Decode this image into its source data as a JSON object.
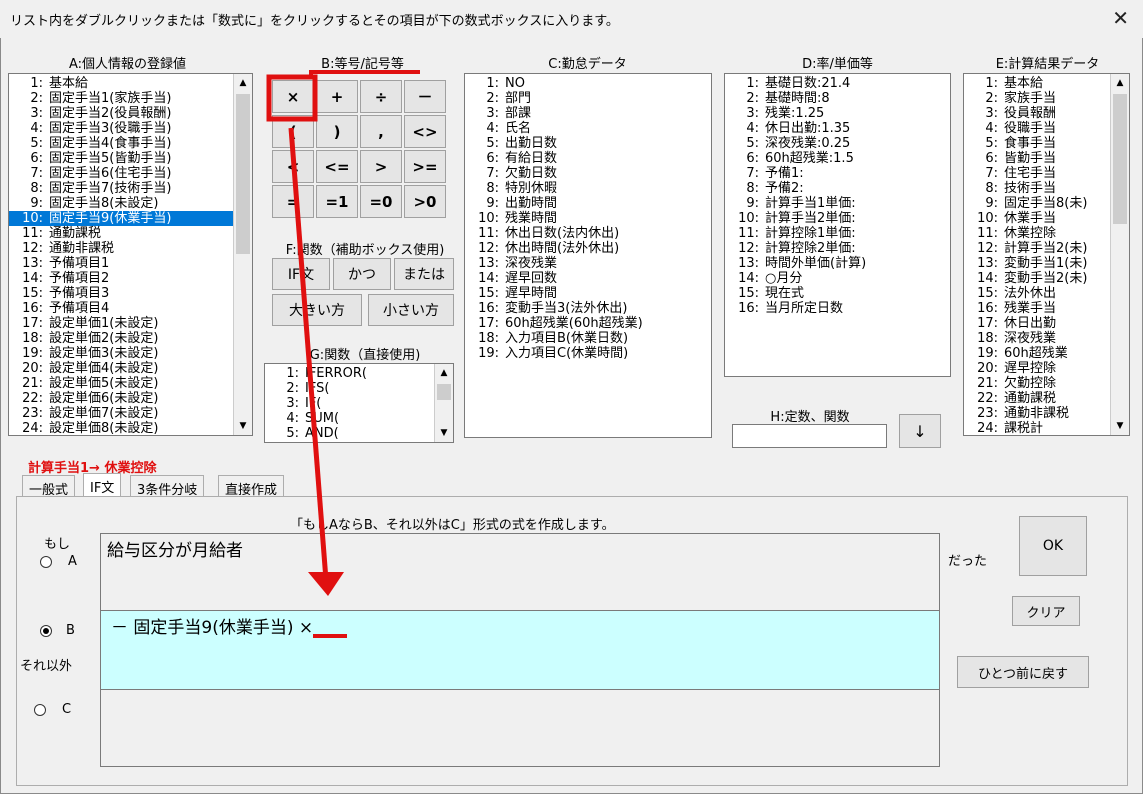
{
  "window": {
    "title": "リスト内をダブルクリックまたは「数式に」をクリックするとその項目が下の数式ボックスに入ります。",
    "close": "✕"
  },
  "panelA": {
    "header": "A:個人情報の登録値",
    "items": [
      {
        "n": "1:",
        "t": "基本給"
      },
      {
        "n": "2:",
        "t": "固定手当1(家族手当)"
      },
      {
        "n": "3:",
        "t": "固定手当2(役員報酬)"
      },
      {
        "n": "4:",
        "t": "固定手当3(役職手当)"
      },
      {
        "n": "5:",
        "t": "固定手当4(食事手当)"
      },
      {
        "n": "6:",
        "t": "固定手当5(皆勤手当)"
      },
      {
        "n": "7:",
        "t": "固定手当6(住宅手当)"
      },
      {
        "n": "8:",
        "t": "固定手当7(技術手当)"
      },
      {
        "n": "9:",
        "t": "固定手当8(未設定)"
      },
      {
        "n": "10:",
        "t": "固定手当9(休業手当)"
      },
      {
        "n": "11:",
        "t": "通勤課税"
      },
      {
        "n": "12:",
        "t": "通勤非課税"
      },
      {
        "n": "13:",
        "t": "予備項目1"
      },
      {
        "n": "14:",
        "t": "予備項目2"
      },
      {
        "n": "15:",
        "t": "予備項目3"
      },
      {
        "n": "16:",
        "t": "予備項目4"
      },
      {
        "n": "17:",
        "t": "設定単価1(未設定)"
      },
      {
        "n": "18:",
        "t": "設定単価2(未設定)"
      },
      {
        "n": "19:",
        "t": "設定単価3(未設定)"
      },
      {
        "n": "20:",
        "t": "設定単価4(未設定)"
      },
      {
        "n": "21:",
        "t": "設定単価5(未設定)"
      },
      {
        "n": "22:",
        "t": "設定単価6(未設定)"
      },
      {
        "n": "23:",
        "t": "設定単価7(未設定)"
      },
      {
        "n": "24:",
        "t": "設定単価8(未設定)"
      }
    ],
    "selected_index": 9
  },
  "panelB": {
    "header": "B:等号/記号等",
    "buttons": [
      [
        "×",
        "+",
        "÷",
        "－"
      ],
      [
        "(",
        ")",
        ",",
        "<>"
      ],
      [
        "<",
        "<=",
        ">",
        ">="
      ],
      [
        "=",
        "=1",
        "=0",
        ">0"
      ]
    ]
  },
  "panelF": {
    "header": "F:関数（補助ボックス使用)",
    "buttons": [
      "IF文",
      "かつ",
      "または",
      "大きい方",
      "小さい方"
    ]
  },
  "panelG": {
    "header": "G:関数（直接使用)",
    "items": [
      {
        "n": "1:",
        "t": "IFERROR("
      },
      {
        "n": "2:",
        "t": "IFS("
      },
      {
        "n": "3:",
        "t": "IF("
      },
      {
        "n": "4:",
        "t": "SUM("
      },
      {
        "n": "5:",
        "t": "AND("
      }
    ]
  },
  "panelC": {
    "header": "C:勤怠データ",
    "items": [
      {
        "n": "1:",
        "t": "NO"
      },
      {
        "n": "2:",
        "t": "部門"
      },
      {
        "n": "3:",
        "t": "部課"
      },
      {
        "n": "4:",
        "t": "氏名"
      },
      {
        "n": "5:",
        "t": "出勤日数"
      },
      {
        "n": "6:",
        "t": "有給日数"
      },
      {
        "n": "7:",
        "t": "欠勤日数"
      },
      {
        "n": "8:",
        "t": "特別休暇"
      },
      {
        "n": "9:",
        "t": "出勤時間"
      },
      {
        "n": "10:",
        "t": "残業時間"
      },
      {
        "n": "11:",
        "t": "休出日数(法内休出)"
      },
      {
        "n": "12:",
        "t": "休出時間(法外休出)"
      },
      {
        "n": "13:",
        "t": "深夜残業"
      },
      {
        "n": "14:",
        "t": "遅早回数"
      },
      {
        "n": "15:",
        "t": "遅早時間"
      },
      {
        "n": "16:",
        "t": "変動手当3(法外休出)"
      },
      {
        "n": "17:",
        "t": "60h超残業(60h超残業)"
      },
      {
        "n": "18:",
        "t": "入力項目B(休業日数)"
      },
      {
        "n": "19:",
        "t": "入力項目C(休業時間)"
      }
    ]
  },
  "panelD": {
    "header": "D:率/単価等",
    "items": [
      {
        "n": "1:",
        "t": "基礎日数:21.4"
      },
      {
        "n": "2:",
        "t": "基礎時間:8"
      },
      {
        "n": "3:",
        "t": "残業:1.25"
      },
      {
        "n": "4:",
        "t": "休日出勤:1.35"
      },
      {
        "n": "5:",
        "t": "深夜残業:0.25"
      },
      {
        "n": "6:",
        "t": "60h超残業:1.5"
      },
      {
        "n": "7:",
        "t": "予備1:"
      },
      {
        "n": "8:",
        "t": "予備2:"
      },
      {
        "n": "9:",
        "t": "計算手当1単価:"
      },
      {
        "n": "10:",
        "t": "計算手当2単価:"
      },
      {
        "n": "11:",
        "t": "計算控除1単価:"
      },
      {
        "n": "12:",
        "t": "計算控除2単価:"
      },
      {
        "n": "13:",
        "t": "時間外単価(計算)"
      },
      {
        "n": "14:",
        "t": "○月分"
      },
      {
        "n": "15:",
        "t": "現在式"
      },
      {
        "n": "16:",
        "t": "当月所定日数"
      }
    ]
  },
  "panelH": {
    "header": "H:定数、関数",
    "value": "",
    "arrow": "↓"
  },
  "panelE": {
    "header": "E:計算結果データ",
    "items": [
      {
        "n": "1:",
        "t": "基本給"
      },
      {
        "n": "2:",
        "t": "家族手当"
      },
      {
        "n": "3:",
        "t": "役員報酬"
      },
      {
        "n": "4:",
        "t": "役職手当"
      },
      {
        "n": "5:",
        "t": "食事手当"
      },
      {
        "n": "6:",
        "t": "皆勤手当"
      },
      {
        "n": "7:",
        "t": "住宅手当"
      },
      {
        "n": "8:",
        "t": "技術手当"
      },
      {
        "n": "9:",
        "t": "固定手当8(未)"
      },
      {
        "n": "10:",
        "t": "休業手当"
      },
      {
        "n": "11:",
        "t": "休業控除"
      },
      {
        "n": "12:",
        "t": "計算手当2(未)"
      },
      {
        "n": "13:",
        "t": "変動手当1(未)"
      },
      {
        "n": "14:",
        "t": "変動手当2(未)"
      },
      {
        "n": "15:",
        "t": "法外休出"
      },
      {
        "n": "16:",
        "t": "残業手当"
      },
      {
        "n": "17:",
        "t": "休日出勤"
      },
      {
        "n": "18:",
        "t": "深夜残業"
      },
      {
        "n": "19:",
        "t": "60h超残業"
      },
      {
        "n": "20:",
        "t": "遅早控除"
      },
      {
        "n": "21:",
        "t": "欠勤控除"
      },
      {
        "n": "22:",
        "t": "通勤課税"
      },
      {
        "n": "23:",
        "t": "通勤非課税"
      },
      {
        "n": "24:",
        "t": "課税計"
      }
    ]
  },
  "calc_label": "計算手当1→ 休業控除",
  "tabs": [
    "一般式",
    "IF文",
    "3条件分岐",
    "直接作成"
  ],
  "active_tab": 1,
  "form": {
    "description": "「もしAならB、それ以外はC」形式の式を作成します。",
    "moshi": "もし",
    "sore_igai": "それ以外",
    "datta": "だった",
    "radioA": "A",
    "radioB": "B",
    "radioC": "C",
    "fieldA": "給与区分が月給者",
    "fieldB": "－ 固定手当9(休業手当) ×",
    "fieldC": "",
    "ok": "OK",
    "clear": "クリア",
    "undo": "ひとつ前に戻す"
  },
  "colors": {
    "accent_red": "#e01010",
    "selection": "#0078d7",
    "fieldB_bg": "#ccffff"
  }
}
